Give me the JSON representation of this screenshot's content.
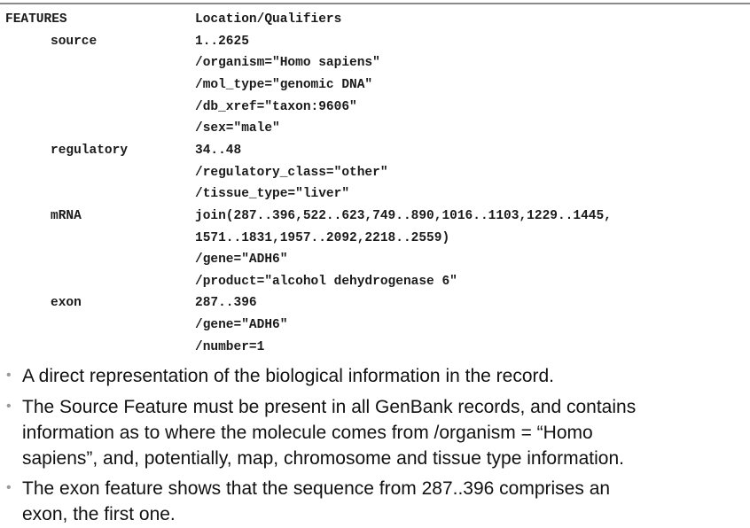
{
  "genbank": {
    "header": {
      "key": "FEATURES",
      "value": "Location/Qualifiers"
    },
    "features": [
      {
        "key": "source",
        "lines": [
          "1..2625",
          "/organism=\"Homo sapiens\"",
          "/mol_type=\"genomic DNA\"",
          "/db_xref=\"taxon:9606\"",
          "/sex=\"male\""
        ]
      },
      {
        "key": "regulatory",
        "lines": [
          "34..48",
          "/regulatory_class=\"other\"",
          "/tissue_type=\"liver\""
        ]
      },
      {
        "key": "mRNA",
        "lines": [
          "join(287..396,522..623,749..890,1016..1103,1229..1445,",
          "1571..1831,1957..2092,2218..2559)",
          "/gene=\"ADH6\"",
          "/product=\"alcohol dehydrogenase 6\""
        ]
      },
      {
        "key": "exon",
        "lines": [
          "287..396",
          "/gene=\"ADH6\"",
          "/number=1"
        ]
      }
    ]
  },
  "bullets": [
    {
      "lines": [
        "A direct representation of the biological information in the record."
      ]
    },
    {
      "lines": [
        "The Source Feature must be present in all GenBank records, and contains",
        "information as to where the molecule comes from /organism = “Homo",
        "sapiens”, and, potentially, map, chromosome and tissue type information."
      ]
    },
    {
      "lines": [
        "The exon feature shows that the sequence from 287..396 comprises an",
        "exon, the first one."
      ]
    }
  ],
  "bullet_symbol": "•"
}
